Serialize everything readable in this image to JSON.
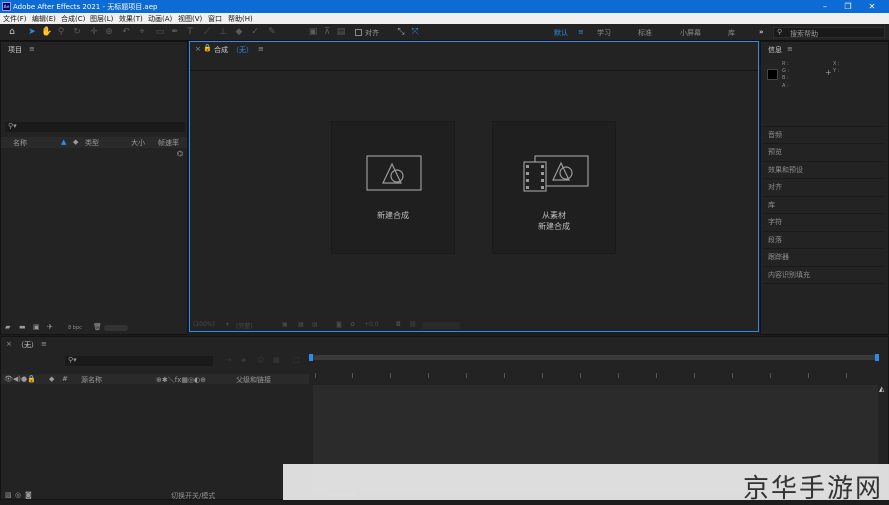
{
  "window": {
    "title": "Adobe After Effects 2021 - 无标题项目.aep",
    "app_icon_text": "Ae"
  },
  "menu": [
    "文件(F)",
    "编辑(E)",
    "合成(C)",
    "图层(L)",
    "效果(T)",
    "动画(A)",
    "视图(V)",
    "窗口",
    "帮助(H)"
  ],
  "toolbar": {
    "align_label": "对齐",
    "search_placeholder": "搜索帮助",
    "more": "»"
  },
  "workspaces": {
    "items": [
      "默认",
      "学习",
      "标准",
      "小屏幕",
      "库"
    ],
    "active": "默认"
  },
  "project_panel": {
    "tab": "项目",
    "columns": [
      "名称",
      "类型",
      "大小",
      "帧速率"
    ],
    "bpc": "8 bpc"
  },
  "composition_panel": {
    "tab": "合成",
    "tab_sub": "（无）",
    "new_comp_label": "新建合成",
    "from_footage_line1": "从素材",
    "from_footage_line2": "新建合成",
    "footer": {
      "zoom": "(100%)",
      "quality": "(完整)",
      "exposure": "+0.0"
    }
  },
  "info_panel": {
    "tab": "信息",
    "r": "R :",
    "g": "G :",
    "b": "B :",
    "a": "A :",
    "x": "X :",
    "y": "Y :"
  },
  "right_panels": [
    "音频",
    "预览",
    "效果和预设",
    "对齐",
    "库",
    "字符",
    "段落",
    "跟踪器",
    "内容识别填充"
  ],
  "timeline": {
    "tab": "（无）",
    "columns": {
      "source": "源名称",
      "parent": "父级和链接"
    },
    "footer_label": "切换开关/模式"
  },
  "watermark": "京华手游网",
  "colors": {
    "accent": "#2d8ceb",
    "title_bar": "#0d6bd6",
    "panel": "#232323"
  }
}
